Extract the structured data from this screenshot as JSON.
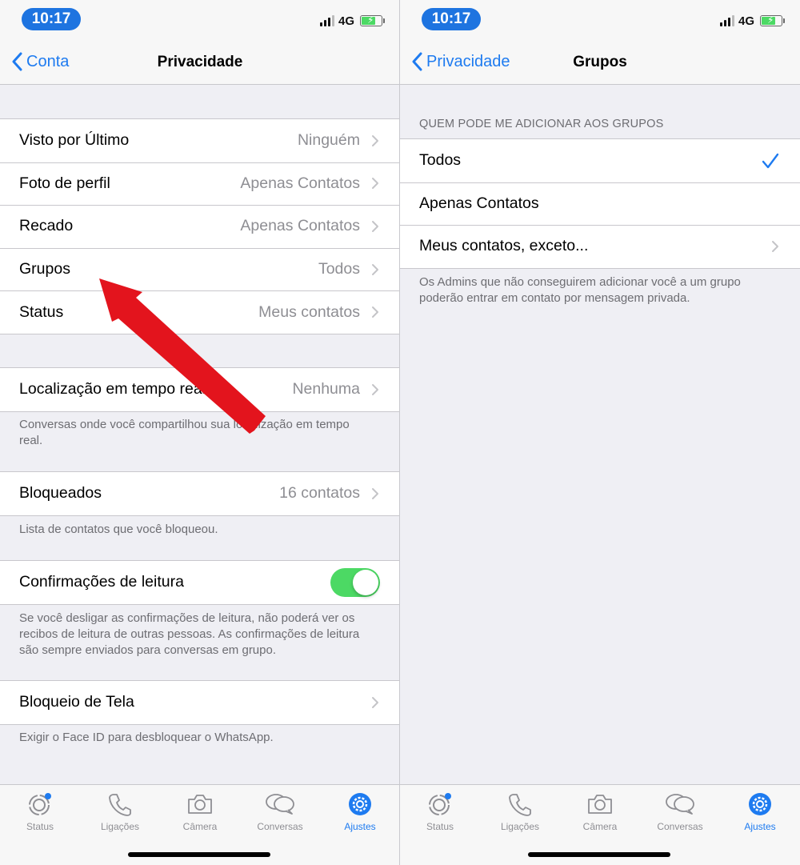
{
  "status_bar": {
    "time": "10:17",
    "network": "4G"
  },
  "left": {
    "nav": {
      "back_label": "Conta",
      "title": "Privacidade"
    },
    "group1": [
      {
        "label": "Visto por Último",
        "value": "Ninguém"
      },
      {
        "label": "Foto de perfil",
        "value": "Apenas Contatos"
      },
      {
        "label": "Recado",
        "value": "Apenas Contatos"
      },
      {
        "label": "Grupos",
        "value": "Todos"
      },
      {
        "label": "Status",
        "value": "Meus contatos"
      }
    ],
    "location": {
      "label": "Localização em tempo real",
      "value": "Nenhuma",
      "note": "Conversas onde você compartilhou sua localização em tempo real."
    },
    "blocked": {
      "label": "Bloqueados",
      "value": "16 contatos",
      "note": "Lista de contatos que você bloqueou."
    },
    "read_receipts": {
      "label": "Confirmações de leitura",
      "enabled": true,
      "note": "Se você desligar as confirmações de leitura, não poderá ver os recibos de leitura de outras pessoas. As confirmações de leitura são sempre enviados para conversas em grupo."
    },
    "screen_lock": {
      "label": "Bloqueio de Tela",
      "note": "Exigir o Face ID para desbloquear o WhatsApp."
    }
  },
  "right": {
    "nav": {
      "back_label": "Privacidade",
      "title": "Grupos"
    },
    "section_header": "QUEM PODE ME ADICIONAR AOS GRUPOS",
    "options": [
      {
        "label": "Todos",
        "selected": true
      },
      {
        "label": "Apenas Contatos",
        "selected": false
      },
      {
        "label": "Meus contatos, exceto...",
        "selected": false
      }
    ],
    "note": "Os Admins que não conseguirem adicionar você a um grupo poderão entrar em contato por mensagem privada."
  },
  "tab_bar": {
    "tabs": [
      {
        "label": "Status",
        "icon": "status-icon"
      },
      {
        "label": "Ligações",
        "icon": "phone-icon"
      },
      {
        "label": "Câmera",
        "icon": "camera-icon"
      },
      {
        "label": "Conversas",
        "icon": "chat-bubbles-icon"
      },
      {
        "label": "Ajustes",
        "icon": "settings-gear-icon",
        "active": true
      }
    ]
  },
  "colors": {
    "accent": "#1e7bf0",
    "toggle_on": "#4cd964",
    "annotation_arrow": "#e3141d",
    "background": "#efeff4"
  }
}
